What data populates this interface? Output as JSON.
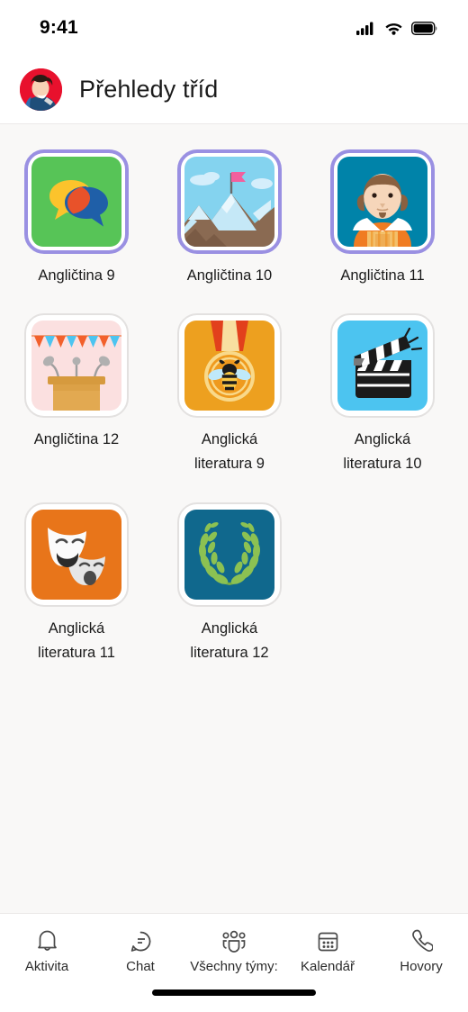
{
  "status_bar": {
    "time": "9:41",
    "icons": [
      "signal-icon",
      "wifi-icon",
      "battery-icon"
    ]
  },
  "header": {
    "title": "Přehledy tříd",
    "avatar": "user-avatar"
  },
  "colors": {
    "selected_border": "#9a90e2",
    "plain_border": "#e3e1e0",
    "page_background": "#f9f8f7",
    "surface": "#ffffff",
    "text": "#1b1b1b"
  },
  "classes": [
    {
      "label": "Angličtina 9",
      "icon": "speech-bubbles-icon",
      "selected": true
    },
    {
      "label": "Angličtina 10",
      "icon": "mountain-flag-icon",
      "selected": true
    },
    {
      "label": "Angličtina 11",
      "icon": "shakespeare-icon",
      "selected": true
    },
    {
      "label": "Angličtina 12",
      "icon": "podium-microphone-icon",
      "selected": false
    },
    {
      "label": "Anglická\nliteratura 9",
      "icon": "spelling-bee-medal-icon",
      "selected": false
    },
    {
      "label": "Anglická\nliteratura 10",
      "icon": "clapperboard-icon",
      "selected": false
    },
    {
      "label": "Anglická\nliteratura 11",
      "icon": "theater-masks-icon",
      "selected": false
    },
    {
      "label": "Anglická\nliteratura 12",
      "icon": "laurel-wreath-icon",
      "selected": false
    }
  ],
  "bottom_nav": [
    {
      "label": "Aktivita",
      "icon": "bell-icon"
    },
    {
      "label": "Chat",
      "icon": "chat-bubble-icon"
    },
    {
      "label": "Všechny týmy:",
      "icon": "people-team-icon"
    },
    {
      "label": "Kalendář",
      "icon": "calendar-icon"
    },
    {
      "label": "Hovory",
      "icon": "phone-icon"
    }
  ]
}
